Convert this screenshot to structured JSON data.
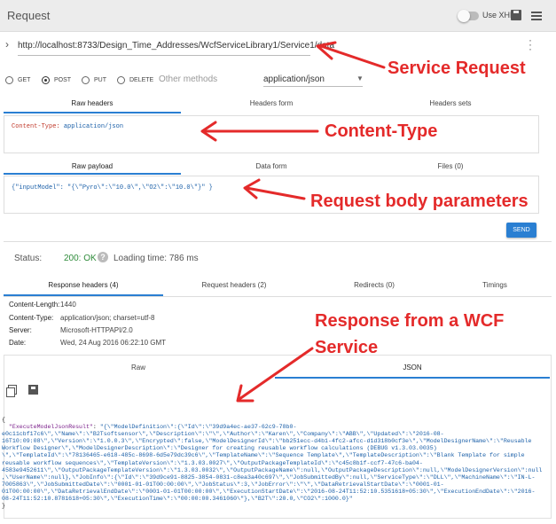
{
  "app": {
    "title": "Request",
    "xhr_label": "Use XHR"
  },
  "url": {
    "value": "http://localhost:8733/Design_Time_Addresses/WcfServiceLibrary1/Service1/data"
  },
  "methods": [
    {
      "label": "GET",
      "selected": false
    },
    {
      "label": "POST",
      "selected": true
    },
    {
      "label": "PUT",
      "selected": false
    },
    {
      "label": "DELETE",
      "selected": false
    }
  ],
  "other_methods": "Other methods",
  "content_type_select": "application/json",
  "header_tabs": [
    "Raw headers",
    "Headers form",
    "Headers sets"
  ],
  "raw_header": {
    "name": "Content-Type:",
    "value": "application/json"
  },
  "payload_tabs": [
    "Raw payload",
    "Data form",
    "Files (0)"
  ],
  "payload": "{\"inputModel\": \"{\\\"Pyro\\\":\\\"10.0\\\",\\\"O2\\\":\\\"10.0\\\"}\" }",
  "send_label": "SEND",
  "status": {
    "label": "Status:",
    "code": "200: OK",
    "help": "?",
    "loading": "Loading time: 786 ms"
  },
  "response_tabs": [
    "Response headers (4)",
    "Request headers (2)",
    "Redirects (0)",
    "Timings"
  ],
  "response_headers": [
    {
      "name": "Content-Length:",
      "value": "1440"
    },
    {
      "name": "Content-Type:",
      "value": "application/json; charset=utf-8"
    },
    {
      "name": "Server:",
      "value": "Microsoft-HTTPAPI/2.0"
    },
    {
      "name": "Date:",
      "value": "Wed, 24 Aug 2016 06:22:10 GMT"
    }
  ],
  "body_tabs": [
    "Raw",
    "JSON"
  ],
  "response_json": {
    "open": "{",
    "key": "\"ExecuteModelJsonResult\"",
    "lines": [
      "\"{\\\"ModelDefinition\\\":{\\\"Id\\\":\\\"39d9a4ec-ae37-62c9-78b0-",
      "e0c11cbf17c6\\\",\\\"Name\\\":\\\"B2Tsoftsensor\\\",\\\"Description\\\":\\\"\\\",\\\"Author\\\":\\\"Karen\\\",\\\"Company\\\":\\\"ABB\\\",\\\"Updated\\\":\\\"2016-08-",
      "16T10:09:08\\\",\\\"Version\\\":\\\"1.0.0.3\\\",\\\"Encrypted\\\":false,\\\"ModelDesignerId\\\":\\\"bb251ecc-d4b1-4fc2-afcc-d1d318b0cf3e\\\",\\\"ModelDesignerName\\\":\\\"Reusable",
      "Workflow Designer\\\",\\\"ModelDesignerDescription\\\":\\\"Designer for creating reusable workflow calculations (DEBUG v1.3.03.0035)",
      "\\\",\\\"TemplateId\\\":\\\"78136465-e618-485c-8698-6d5e79dc39c6\\\",\\\"TemplateName\\\":\\\"Sequence Template\\\",\\\"TemplateDescription\\\":\\\"Blank Template for simple",
      "reusable workflow sequences\\\",\\\"TemplateVersion\\\":\\\"1.3.03.0027\\\",\\\"OutputPackageTemplateId\\\":\\\"c45c8b1f-ccf7-47c6-ba04-",
      "4583e9452611\\\",\\\"OutputPackageTemplateVersion\\\":\\\"1.3.03.0032\\\",\\\"OutputPackageName\\\":null,\\\"OutputPackageDescription\\\":null,\\\"ModelDesignerVersion\\\":null",
      ",\\\"UserName\\\":null},\\\"JobInfo\\\":{\\\"Id\\\":\\\"39d9ce91-8825-3854-0831-c8ea3a40c697\\\",\\\"JobSubmittedBy\\\":null,\\\"ServiceType\\\":\\\"DLL\\\",\\\"MachineName\\\":\\\"IN-L-",
      "7005863\\\",\\\"JobSubmittedDate\\\":\\\"0001-01-01T00:00:00\\\",\\\"JobStatus\\\":3,\\\"JobError\\\":\\\"\\\",\\\"DataRetrievalStartDate\\\":\\\"0001-01-",
      "01T00:00:00\\\",\\\"DataRetrievalEndDate\\\":\\\"0001-01-01T00:00:00\\\",\\\"ExecutionStartDate\\\":\\\"2016-08-24T11:52:10.5351618+05:30\\\",\\\"ExecutionEndDate\\\":\\\"2016-",
      "08-24T11:52:10.8781618+05:30\\\",\\\"ExecutionTime\\\":\\\"00:00:00.3461060\\\"},\\\"B2T\\\":20.0,\\\"CO2\\\":1000.0}\""
    ],
    "close": "}"
  },
  "annotations": {
    "service_request": "Service Request",
    "content_type": "Content-Type",
    "request_body": "Request body parameters",
    "response_line1": "Response from a WCF",
    "response_line2": "Service",
    "color": "#e42a2a"
  },
  "colors": {
    "accent": "#2a7fd2",
    "status_ok": "#2e8b3a"
  }
}
